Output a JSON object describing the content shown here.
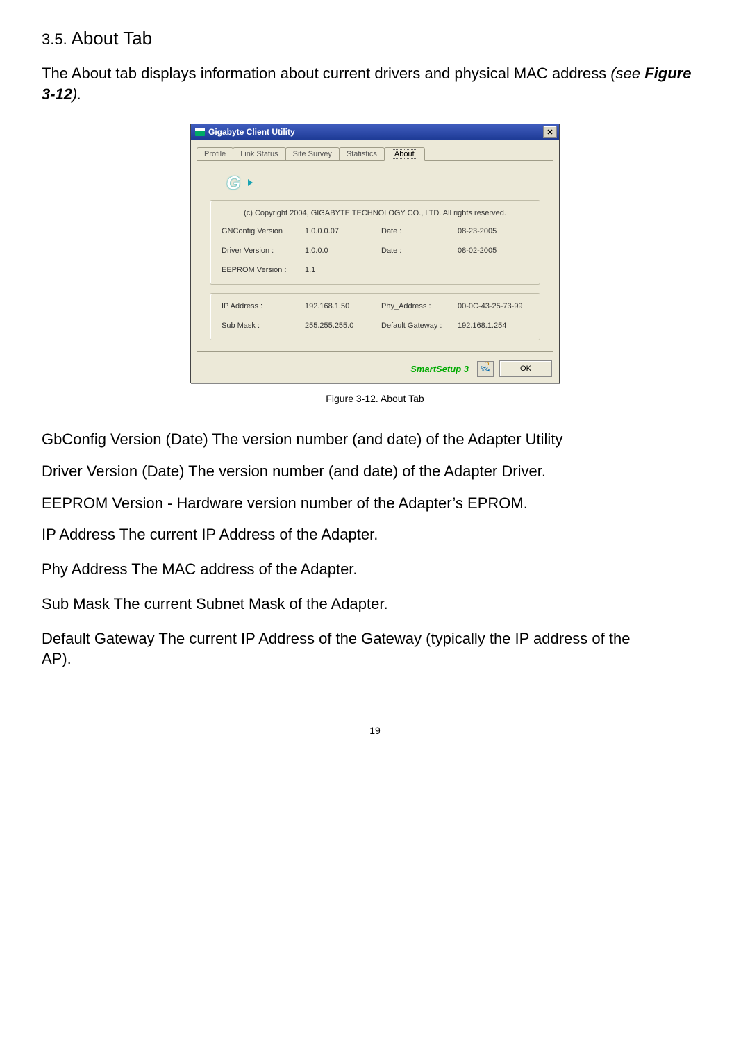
{
  "heading": {
    "num": "3.5.",
    "title": "About Tab"
  },
  "intro": {
    "text": "The About  tab displays information about current drivers and physical MAC address ",
    "ref_open": "(see ",
    "ref_bold": "Figure 3-12",
    "ref_close": ")."
  },
  "dialog": {
    "title": "Gigabyte Client Utility",
    "close_x": "✕",
    "tabs": [
      "Profile",
      "Link Status",
      "Site Survey",
      "Statistics",
      "About"
    ],
    "logo": "G",
    "copyright": "(c) Copyright 2004, GIGABYTE TECHNOLOGY CO., LTD.  All rights reserved.",
    "g1": {
      "r1": {
        "l": "GNConfig Version",
        "v": "1.0.0.0.07",
        "dl": "Date :",
        "dv": "08-23-2005"
      },
      "r2": {
        "l": "Driver Version :",
        "v": "1.0.0.0",
        "dl": "Date :",
        "dv": "08-02-2005"
      },
      "r3": {
        "l": "EEPROM Version :",
        "v": "1.1"
      }
    },
    "g2": {
      "r1": {
        "l": "IP Address :",
        "v": "192.168.1.50",
        "dl": "Phy_Address :",
        "dv": "00-0C-43-25-73-99"
      },
      "r2": {
        "l": "Sub Mask :",
        "v": "255.255.255.0",
        "dl": "Default Gateway :",
        "dv": "192.168.1.254"
      }
    },
    "smartsetup": "SmartSetup 3",
    "ok": "OK"
  },
  "caption": "Figure 3-12.    About Tab",
  "descs": {
    "d1": {
      "term": "GbConfig Version (Date)",
      "body": "      The version number (and date) of the Adapter Utility"
    },
    "d2": {
      "term": "Driver Version (Date)",
      "body": "      The version number (and date) of the Adapter Driver."
    },
    "d3": {
      "term": "EEPROM Version -",
      "body": "  Hardware version number of the Adapter’s EPROM."
    },
    "d4": {
      "term": "IP Address",
      "body": "     The current IP Address of the Adapter."
    },
    "d5": {
      "term": "Phy Address",
      "body": "     The MAC address of the Adapter."
    },
    "d6": {
      "term": "Sub Mask",
      "body": "    The current Subnet Mask of the Adapter."
    },
    "d7a": {
      "term": "Default Gateway",
      "body": "      The current IP Address of the Gateway (typically the IP address of the "
    },
    "d7b": "AP)."
  },
  "page_num": "19"
}
